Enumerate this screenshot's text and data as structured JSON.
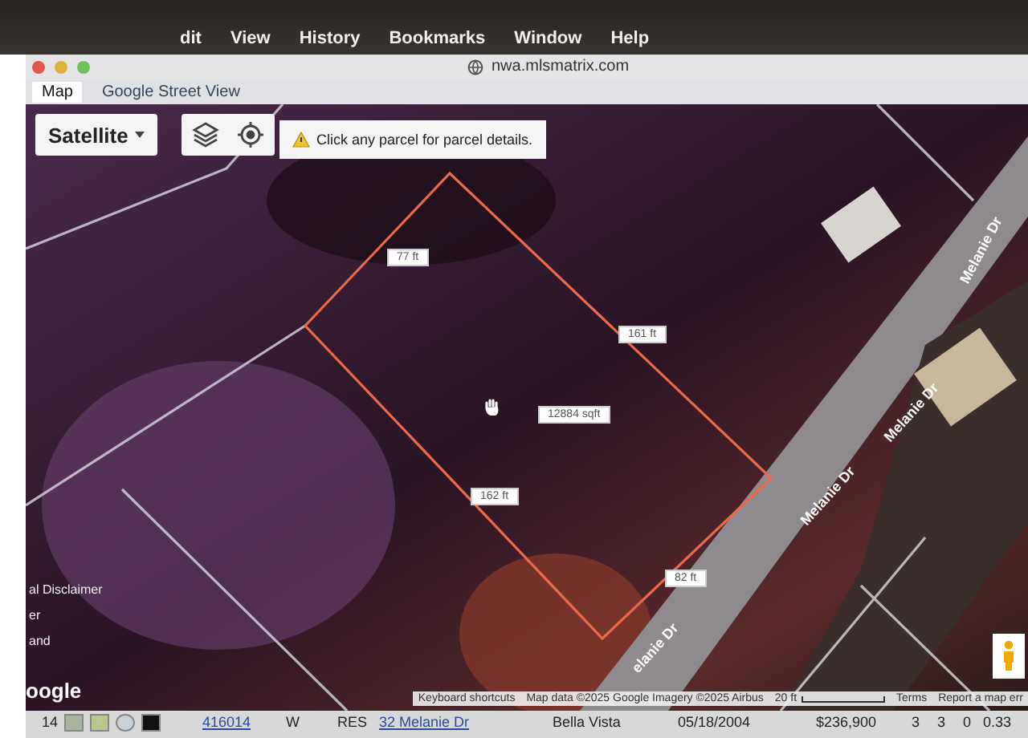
{
  "menu_bar": {
    "items": [
      "dit",
      "View",
      "History",
      "Bookmarks",
      "Window",
      "Help"
    ]
  },
  "address_bar": {
    "url": "nwa.mlsmatrix.com"
  },
  "tabs": [
    {
      "label": "Map",
      "selected": true
    },
    {
      "label": "Google Street View",
      "selected": false
    }
  ],
  "map": {
    "map_type_button": "Satellite",
    "notice": "Click any parcel for parcel details.",
    "measurements": [
      "77 ft",
      "161 ft",
      "12884 sqft",
      "162 ft",
      "82 ft"
    ],
    "street_labels": [
      "Melanie Dr",
      "Melanie Dr",
      "Melanie Dr",
      "elanie Dr"
    ],
    "side_texts": [
      "al Disclaimer",
      "er",
      "and"
    ],
    "logo": "oogle",
    "attribution": [
      "Keyboard shortcuts",
      "Map data ©2025 Google Imagery ©2025 Airbus",
      "20 ft",
      "Terms",
      "Report a map err"
    ]
  },
  "table_row": {
    "cells": [
      "14",
      "416014",
      "W",
      "RES",
      "32 Melanie Dr",
      "Bella Vista",
      "05/18/2004",
      "$236,900",
      "3",
      "3",
      "0",
      "0.33"
    ]
  }
}
